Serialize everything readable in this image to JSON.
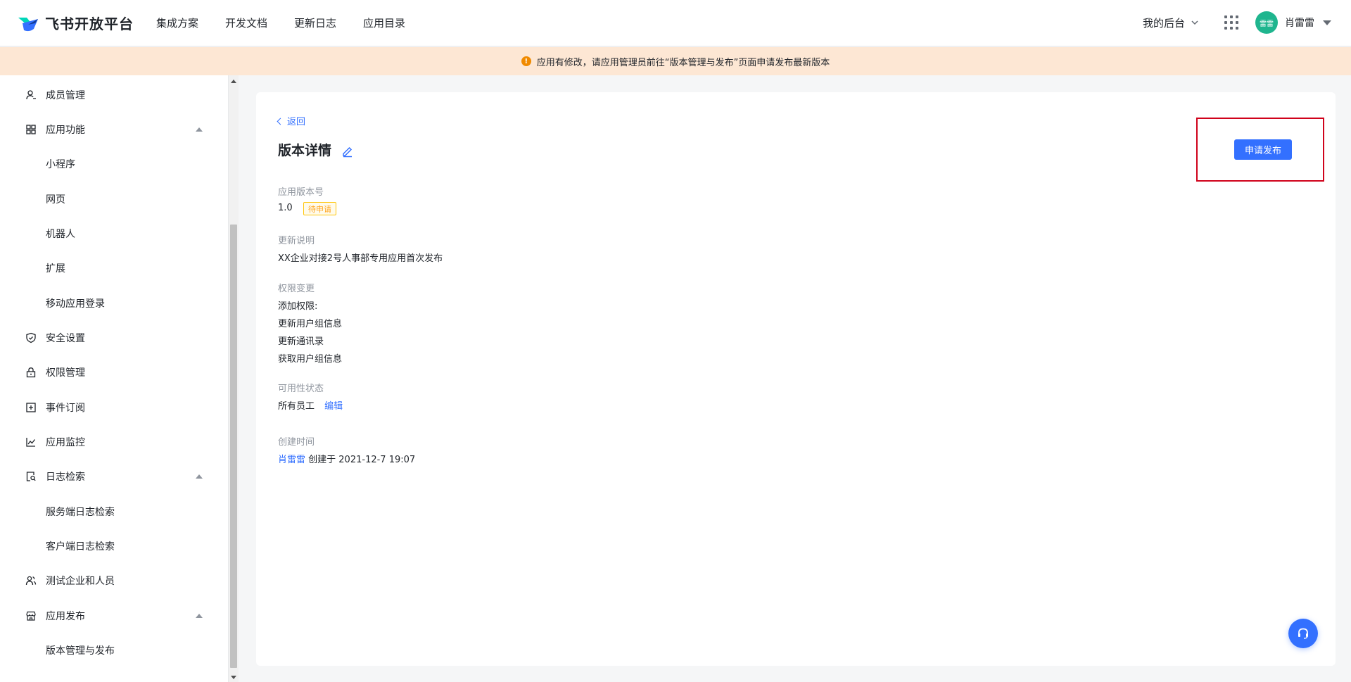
{
  "brand": {
    "name": "飞书开放平台"
  },
  "nav": {
    "links": [
      "集成方案",
      "开发文档",
      "更新日志",
      "应用目录"
    ],
    "console_label": "我的后台",
    "avatar_text": "雷雷",
    "username": "肖雷雷"
  },
  "banner": {
    "text": "应用有修改，请应用管理员前往“版本管理与发布”页面申请发布最新版本"
  },
  "sidebar": {
    "items": [
      {
        "label": "成员管理",
        "icon": "user-icon",
        "level": 1
      },
      {
        "label": "应用功能",
        "icon": "grid-icon",
        "level": 1,
        "expanded": true
      },
      {
        "label": "小程序",
        "level": 2
      },
      {
        "label": "网页",
        "level": 2
      },
      {
        "label": "机器人",
        "level": 2
      },
      {
        "label": "扩展",
        "level": 2
      },
      {
        "label": "移动应用登录",
        "level": 2
      },
      {
        "label": "安全设置",
        "icon": "shield-icon",
        "level": 1
      },
      {
        "label": "权限管理",
        "icon": "lock-icon",
        "level": 1
      },
      {
        "label": "事件订阅",
        "icon": "plus-square-icon",
        "level": 1
      },
      {
        "label": "应用监控",
        "icon": "chart-icon",
        "level": 1
      },
      {
        "label": "日志检索",
        "icon": "log-search-icon",
        "level": 1,
        "expanded": true
      },
      {
        "label": "服务端日志检索",
        "level": 2
      },
      {
        "label": "客户端日志检索",
        "level": 2
      },
      {
        "label": "测试企业和人员",
        "icon": "users-icon",
        "level": 1
      },
      {
        "label": "应用发布",
        "icon": "store-icon",
        "level": 1,
        "expanded": true
      },
      {
        "label": "版本管理与发布",
        "level": 2
      }
    ]
  },
  "detail": {
    "back_label": "返回",
    "title": "版本详情",
    "version_label": "应用版本号",
    "version_value": "1.0",
    "status_badge": "待申请",
    "update_label": "更新说明",
    "update_value": "XX企业对接2号人事部专用应用首次发布",
    "perm_label": "权限变更",
    "perm_add": "添加权限:",
    "perms": [
      "更新用户组信息",
      "更新通讯录",
      "获取用户组信息"
    ],
    "availability_label": "可用性状态",
    "availability_value": "所有员工",
    "availability_edit": "编辑",
    "created_label": "创建时间",
    "created_by": "肖雷雷",
    "created_text": "创建于 2021-12-7 19:07",
    "publish_button": "申请发布"
  },
  "colors": {
    "primary": "#3370ff",
    "banner_bg": "#fde7d4",
    "warning": "#f08a00",
    "highlight": "#d0021b",
    "avatar": "#1fb58e"
  }
}
